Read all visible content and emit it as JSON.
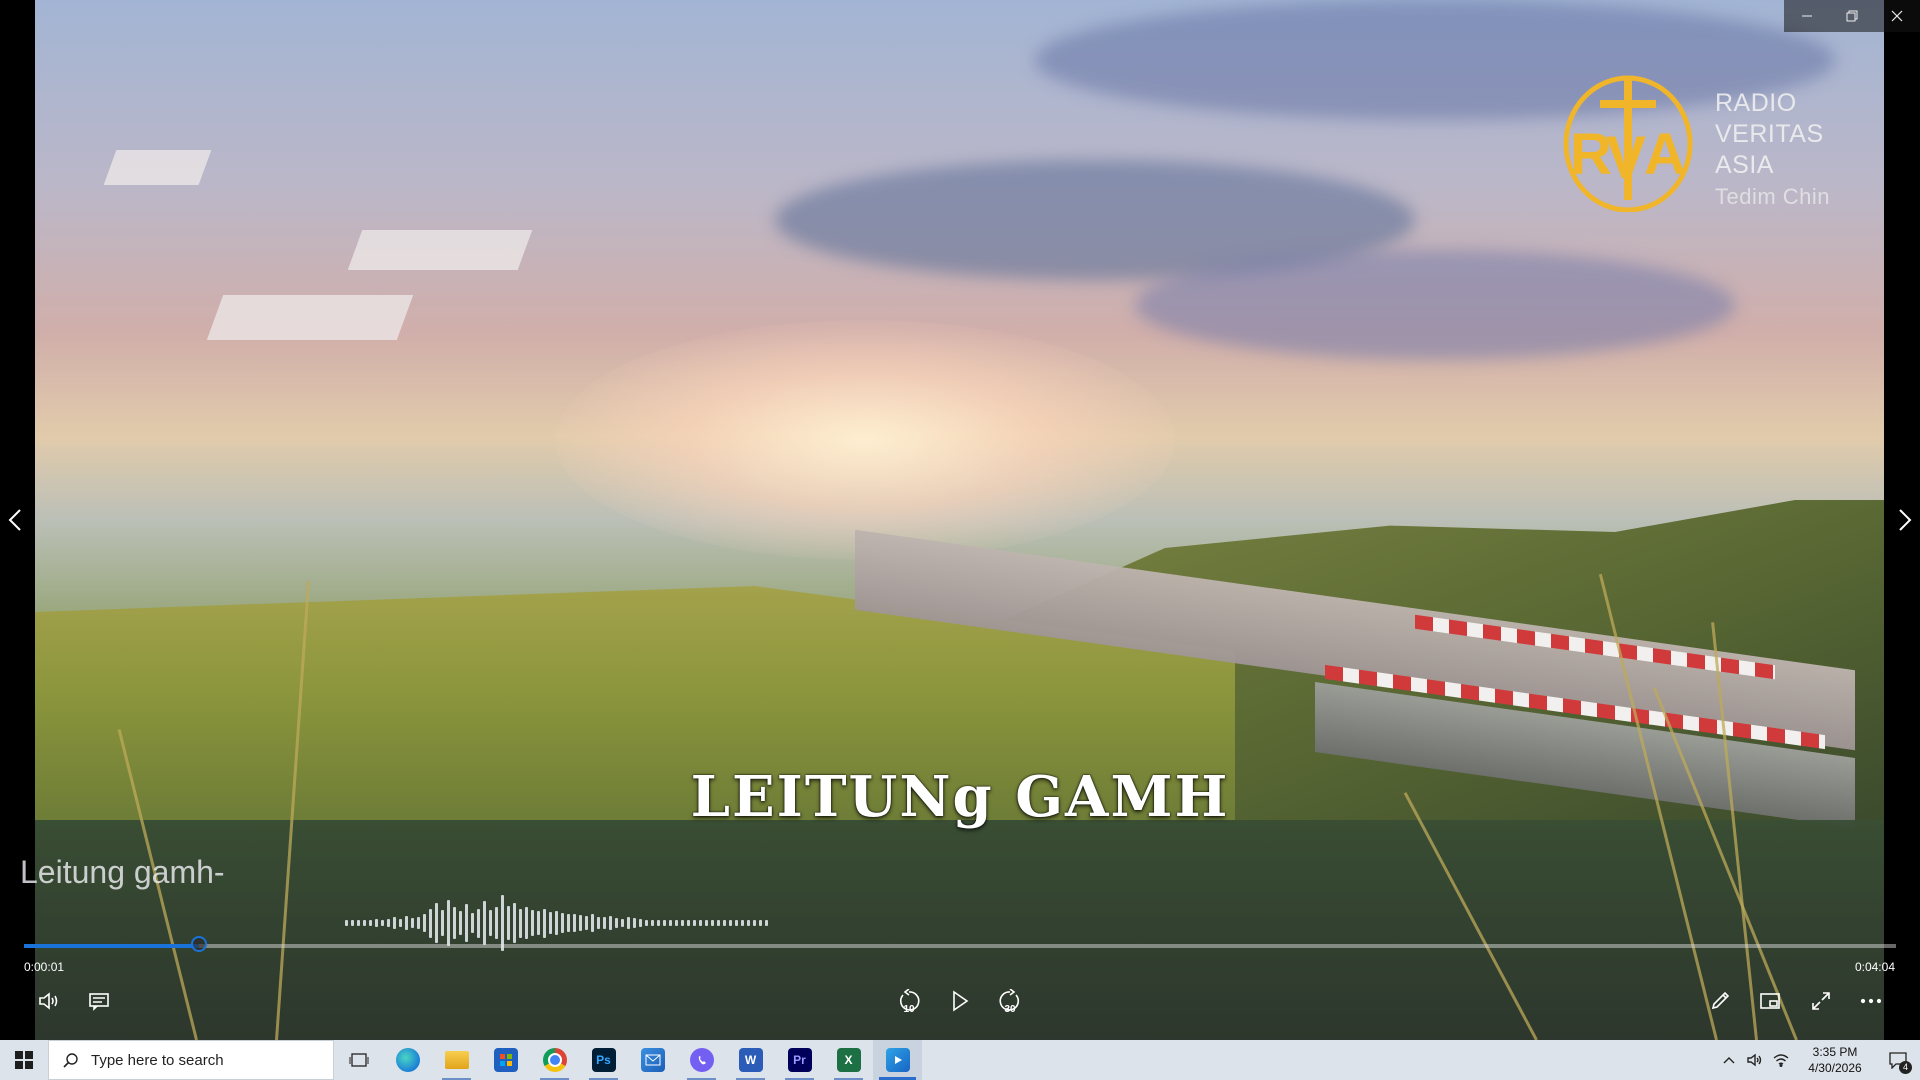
{
  "window": {
    "controls": [
      "minimize",
      "restore",
      "close"
    ]
  },
  "logo": {
    "lines": [
      "RADIO",
      "VERITAS",
      "ASIA"
    ],
    "subline": "Tedim Chin",
    "mark_color": "#f1b52a"
  },
  "video": {
    "title": "LEITUNg GAMH",
    "lyric": "Leitung gamh-",
    "waveform_levels": [
      0.1,
      0.1,
      0.1,
      0.12,
      0.12,
      0.15,
      0.12,
      0.15,
      0.2,
      0.15,
      0.25,
      0.18,
      0.2,
      0.3,
      0.5,
      0.7,
      0.45,
      0.8,
      0.55,
      0.4,
      0.65,
      0.35,
      0.5,
      0.75,
      0.45,
      0.55,
      0.95,
      0.6,
      0.7,
      0.5,
      0.55,
      0.45,
      0.4,
      0.5,
      0.38,
      0.42,
      0.36,
      0.3,
      0.32,
      0.28,
      0.25,
      0.3,
      0.22,
      0.2,
      0.25,
      0.18,
      0.15,
      0.2,
      0.16,
      0.14,
      0.12,
      0.12,
      0.1,
      0.1,
      0.1,
      0.1,
      0.1,
      0.1,
      0.1,
      0.1,
      0.1,
      0.1,
      0.1,
      0.1,
      0.1,
      0.1,
      0.1,
      0.1,
      0.1,
      0.1,
      0.1
    ]
  },
  "player": {
    "current_time": "0:00:01",
    "total_time": "0:04:04",
    "progress_fraction": 0.0935,
    "accent": "#1a73d9",
    "skip_back_seconds": "10",
    "skip_forward_seconds": "30"
  },
  "taskbar": {
    "search_placeholder": "Type here to search",
    "apps": [
      {
        "name": "task-view",
        "label": ""
      },
      {
        "name": "edge",
        "label": ""
      },
      {
        "name": "file-explorer",
        "label": ""
      },
      {
        "name": "store",
        "label": ""
      },
      {
        "name": "chrome",
        "label": ""
      },
      {
        "name": "photoshop",
        "label": "Ps"
      },
      {
        "name": "mail",
        "label": ""
      },
      {
        "name": "viber",
        "label": ""
      },
      {
        "name": "word",
        "label": "W"
      },
      {
        "name": "premiere",
        "label": "Pr"
      },
      {
        "name": "excel",
        "label": "X"
      },
      {
        "name": "media-player",
        "label": ""
      }
    ],
    "clock_time": "3:35 PM",
    "clock_date": "4/30/2026",
    "notification_count": "4"
  }
}
